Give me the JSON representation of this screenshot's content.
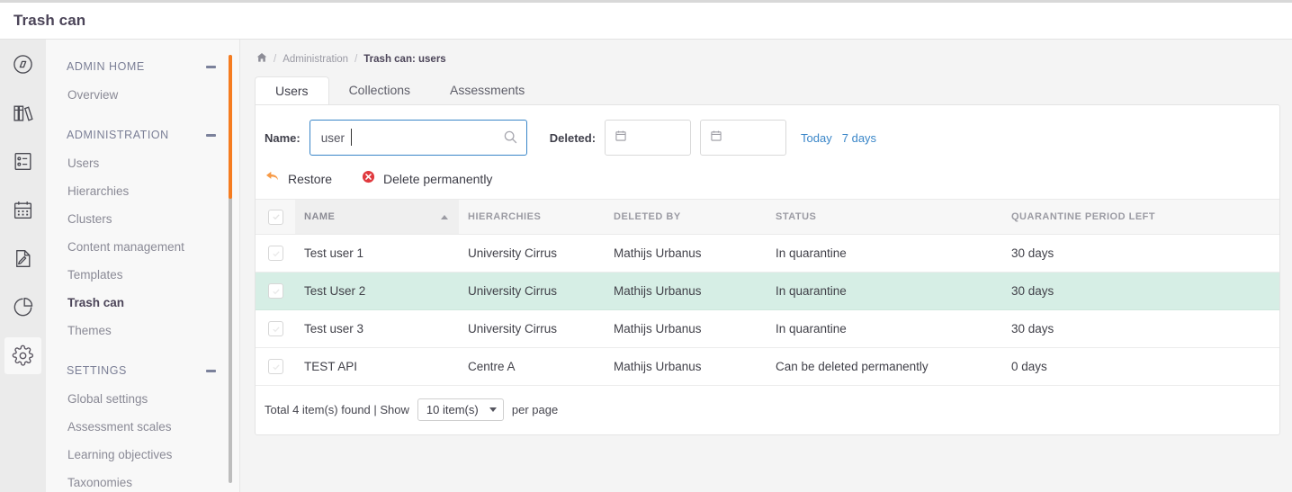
{
  "app": {
    "title": "Trash can"
  },
  "rail": {
    "items": [
      {
        "icon": "compass-icon",
        "active": false
      },
      {
        "icon": "library-books-icon",
        "active": false
      },
      {
        "icon": "checklist-icon",
        "active": false
      },
      {
        "icon": "calendar-icon",
        "active": false
      },
      {
        "icon": "document-edit-icon",
        "active": false
      },
      {
        "icon": "pie-chart-icon",
        "active": false
      },
      {
        "icon": "gear-icon",
        "active": true
      }
    ]
  },
  "sidebar": {
    "groups": [
      {
        "label": "ADMIN HOME",
        "collapse_icon": "minus-icon",
        "items": [
          {
            "label": "Overview",
            "active": false
          }
        ]
      },
      {
        "label": "ADMINISTRATION",
        "collapse_icon": "minus-icon",
        "items": [
          {
            "label": "Users",
            "active": false
          },
          {
            "label": "Hierarchies",
            "active": false
          },
          {
            "label": "Clusters",
            "active": false
          },
          {
            "label": "Content management",
            "active": false
          },
          {
            "label": "Templates",
            "active": false
          },
          {
            "label": "Trash can",
            "active": true
          },
          {
            "label": "Themes",
            "active": false
          }
        ]
      },
      {
        "label": "SETTINGS",
        "collapse_icon": "minus-icon",
        "items": [
          {
            "label": "Global settings",
            "active": false
          },
          {
            "label": "Assessment scales",
            "active": false
          },
          {
            "label": "Learning objectives",
            "active": false
          },
          {
            "label": "Taxonomies",
            "active": false
          }
        ]
      }
    ]
  },
  "breadcrumb": {
    "home_icon": "home-icon",
    "sep": "/",
    "items": [
      {
        "label": "Administration",
        "current": false
      },
      {
        "label": "Trash can: users",
        "current": true
      }
    ]
  },
  "tabs": [
    {
      "label": "Users",
      "active": true
    },
    {
      "label": "Collections",
      "active": false
    },
    {
      "label": "Assessments",
      "active": false
    }
  ],
  "filters": {
    "name_label": "Name:",
    "name_value": "user",
    "name_placeholder": "",
    "search_icon": "search-icon",
    "deleted_label": "Deleted:",
    "date_from_value": "",
    "date_to_value": "",
    "date_icon": "calendar-icon",
    "quick_today": "Today",
    "quick_7days": "7 days"
  },
  "actions": {
    "restore_label": "Restore",
    "restore_icon": "undo-arrow-icon",
    "delete_label": "Delete permanently",
    "delete_icon": "delete-circle-icon"
  },
  "table": {
    "columns": [
      {
        "key": "check",
        "label": "",
        "sorted": false
      },
      {
        "key": "name",
        "label": "NAME",
        "sorted": true,
        "sort_dir": "asc"
      },
      {
        "key": "hierarchies",
        "label": "HIERARCHIES",
        "sorted": false
      },
      {
        "key": "deleted_by",
        "label": "DELETED BY",
        "sorted": false
      },
      {
        "key": "status",
        "label": "STATUS",
        "sorted": false
      },
      {
        "key": "quarantine",
        "label": "QUARANTINE PERIOD LEFT",
        "sorted": false
      }
    ],
    "rows": [
      {
        "name": "Test user 1",
        "hierarchies": "University Cirrus",
        "deleted_by": "Mathijs Urbanus",
        "status": "In quarantine",
        "quarantine": "30 days",
        "highlighted": false,
        "checked": false
      },
      {
        "name": "Test User 2",
        "hierarchies": "University Cirrus",
        "deleted_by": "Mathijs Urbanus",
        "status": "In quarantine",
        "quarantine": "30 days",
        "highlighted": true,
        "checked": false
      },
      {
        "name": "Test user 3",
        "hierarchies": "University Cirrus",
        "deleted_by": "Mathijs Urbanus",
        "status": "In quarantine",
        "quarantine": "30 days",
        "highlighted": false,
        "checked": false
      },
      {
        "name": "TEST API",
        "hierarchies": "Centre A",
        "deleted_by": "Mathijs Urbanus",
        "status": "Can be deleted permanently",
        "quarantine": "0 days",
        "highlighted": false,
        "checked": false
      }
    ]
  },
  "footer": {
    "total_text": "Total 4 item(s) found | Show",
    "page_size": "10 item(s)",
    "per_page_text": "per page"
  },
  "colors": {
    "accent_orange": "#f57c20",
    "link_blue": "#3a86c8",
    "focus_blue": "#3a86c8",
    "row_highlight": "#d6eee5",
    "danger_red": "#e0393e",
    "restore_orange": "#f79a46",
    "heading_text": "#4b4458"
  }
}
